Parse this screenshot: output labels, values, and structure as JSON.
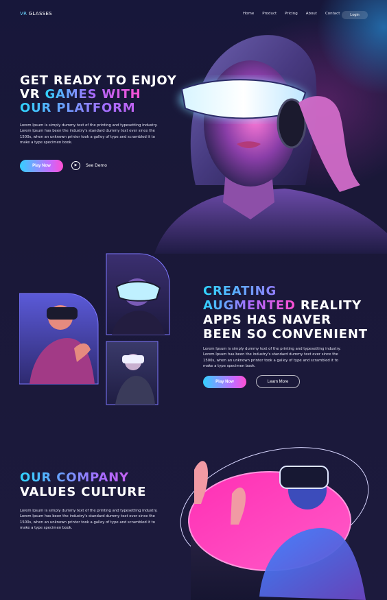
{
  "nav": {
    "logo_vr": "VR",
    "logo_rest": "GLASSES",
    "links": [
      "Home",
      "Product",
      "Pricing",
      "About",
      "Contact"
    ],
    "login": "Login"
  },
  "hero": {
    "title_line1": "GET READY TO ENJOY",
    "title_line2_a": "VR ",
    "title_line2_b": "GAMES WITH",
    "title_line3": "OUR PLATFORM",
    "description": "Lorem Ipsum is simply dummy text of the printing and typesetting industry. Lorem Ipsum has been the industry's standard dummy text ever since the 1500s, when an unknown printer took a galley of type and scrambled it to make a type specimen book.",
    "play_now": "Play Now",
    "see_demo": "See Demo"
  },
  "section2": {
    "title_line1": "CREATING",
    "title_line2_grad": "AUGMENTED",
    "title_line2_rest": " REALITY",
    "title_line3": "APPS HAS NAVER",
    "title_line4": "BEEN SO CONVENIENT",
    "description": "Lorem Ipsum is simply dummy text of the printing and typesetting industry. Lorem Ipsum has been the industry's standard dummy text ever since the 1500s, when an unknown printer took a galley of type and scrambled it to make a type specimen book.",
    "play_now": "Play Now",
    "learn_more": "Learn More"
  },
  "section3": {
    "title_line1": "OUR COMPANY",
    "title_line2": "VALUES CULTURE",
    "description": "Lorem Ipsum is simply dummy text of the printing and typesetting industry. Lorem Ipsum has been the industry's standard dummy text ever since the 1500s, when an unknown printer took a galley of type and scrambled it to make a type specimen book."
  },
  "colors": {
    "background": "#1a1838",
    "accent_cyan": "#2fd4ff",
    "accent_purple": "#a86bff",
    "accent_pink": "#ff4fd1"
  },
  "icons": {
    "play": "play-icon"
  }
}
